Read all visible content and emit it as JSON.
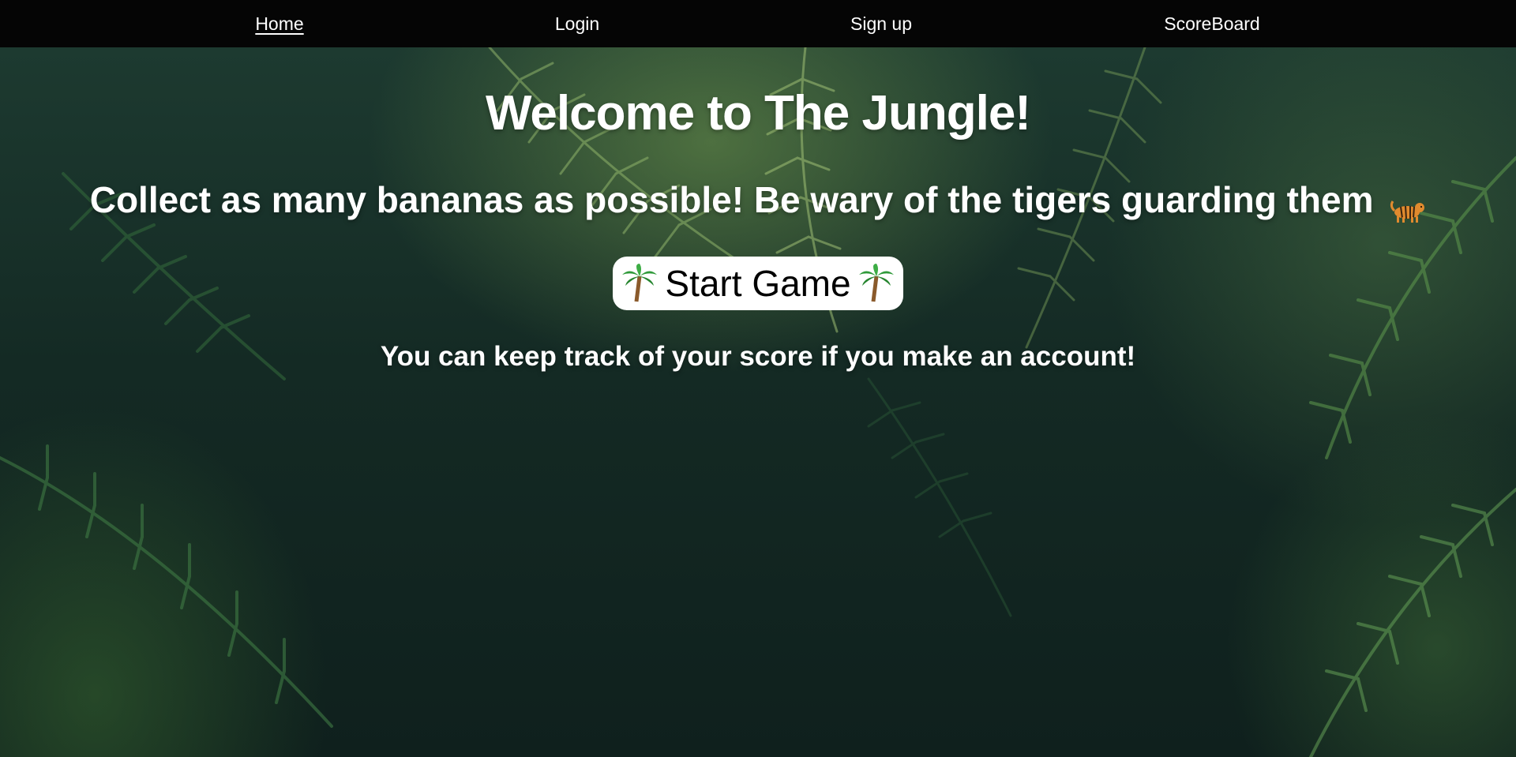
{
  "nav": {
    "items": [
      {
        "label": "Home",
        "active": true
      },
      {
        "label": "Login",
        "active": false
      },
      {
        "label": "Sign up",
        "active": false
      },
      {
        "label": "ScoreBoard",
        "active": false
      }
    ]
  },
  "hero": {
    "title": "Welcome to The Jungle!",
    "subtitle": "Collect as many bananas as possible! Be wary of the tigers guarding them",
    "subtitle_icon": "tiger-icon",
    "start_button_label": "Start Game",
    "start_button_icons": [
      "palm-tree-icon",
      "palm-tree-icon"
    ],
    "account_note": "You can keep track of your score if you make an account!"
  },
  "colors": {
    "navbar_bg": "#050505",
    "text": "#ffffff",
    "button_bg": "#ffffff",
    "button_text": "#000000",
    "jungle_dark": "#0f201d"
  }
}
